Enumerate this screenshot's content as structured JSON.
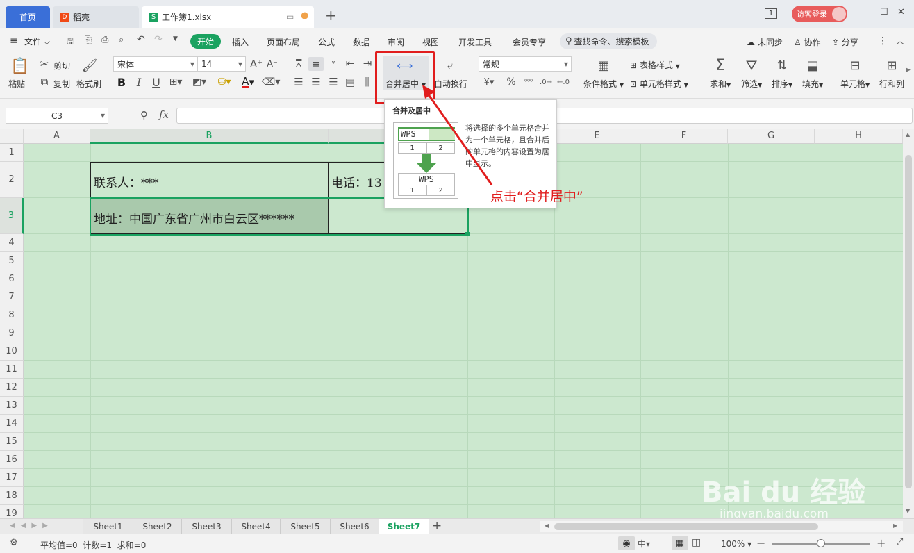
{
  "title_bar": {
    "tabs": [
      {
        "label": "首页"
      },
      {
        "label": "稻壳",
        "icon_text": "D"
      },
      {
        "label": "工作簿1.xlsx",
        "icon_text": "S"
      }
    ],
    "new_tab_symbol": "+",
    "window_count": "1",
    "login_label": "访客登录",
    "min_symbol": "—",
    "max_symbol": "☐",
    "close_symbol": "✕"
  },
  "menu": {
    "file_label": "文件",
    "items": [
      "开始",
      "插入",
      "页面布局",
      "公式",
      "数据",
      "审阅",
      "视图",
      "开发工具",
      "会员专享"
    ],
    "search_label": "查找命令、搜索模板",
    "sync_label": "未同步",
    "collab_label": "协作",
    "share_label": "分享"
  },
  "ribbon": {
    "paste_label": "粘贴",
    "cut_label": "剪切",
    "copy_label": "复制",
    "format_painter_label": "格式刷",
    "font_name": "宋体",
    "font_size": "14",
    "merge_label": "合并居中",
    "wrap_label": "自动换行",
    "number_format": "常规",
    "cond_format_label": "条件格式",
    "table_style_label": "表格样式",
    "cell_style_label": "单元格样式",
    "sum_label": "求和",
    "filter_label": "筛选",
    "sort_label": "排序",
    "fill_label": "填充",
    "cell_label": "单元格",
    "rowcol_label": "行和列"
  },
  "formula_bar": {
    "cell_ref": "C3",
    "fx": "fx"
  },
  "grid": {
    "columns": [
      "A",
      "B",
      "C",
      "D",
      "E",
      "F",
      "G",
      "H"
    ],
    "rows": [
      "1",
      "2",
      "3",
      "4",
      "5",
      "6",
      "7",
      "8",
      "9",
      "10",
      "11",
      "12",
      "13",
      "14",
      "15",
      "16",
      "17",
      "18",
      "19"
    ],
    "cells": {
      "B2": "联系人：***",
      "C2": "电话：13",
      "B3": "地址：中国广东省广州市白云区******"
    }
  },
  "tooltip": {
    "title": "合并及居中",
    "before_text": "WPS",
    "cell_1": "1",
    "cell_2": "2",
    "after_text": "WPS",
    "description": "将选择的多个单元格合并为一个单元格，且合并后的单元格的内容设置为居中显示。"
  },
  "annotation": {
    "text": "点击“合并居中”",
    "color": "#e11d1d"
  },
  "sheets": {
    "tabs": [
      "Sheet1",
      "Sheet2",
      "Sheet3",
      "Sheet4",
      "Sheet5",
      "Sheet6",
      "Sheet7"
    ],
    "active": "Sheet7",
    "add_symbol": "+"
  },
  "status": {
    "summary": "平均值=0  计数=1  求和=0",
    "zoom": "100%",
    "zoom_minus": "−",
    "zoom_plus": "+"
  },
  "watermark": {
    "text": "Bai du 经验",
    "url": "jingyan.baidu.com"
  },
  "colors": {
    "accent_green": "#1aa260",
    "sheet_bg": "#cce8cf",
    "home_tab": "#3a6fd8",
    "annotation_red": "#e11d1d"
  }
}
